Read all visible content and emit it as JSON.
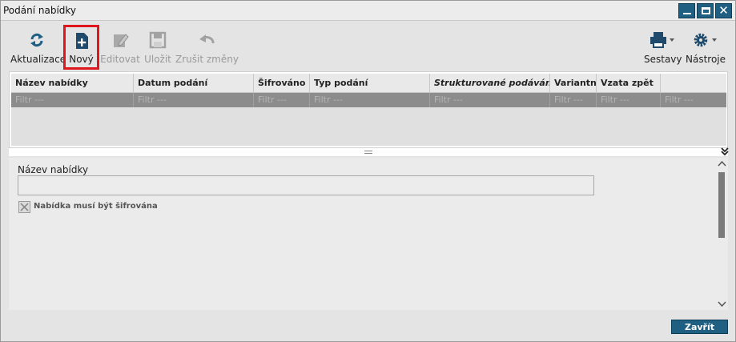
{
  "window": {
    "title": "Podání nabídky",
    "buttons": [
      "minimize",
      "maximize",
      "close"
    ]
  },
  "toolbar": {
    "items": [
      {
        "label": "Aktualizace",
        "icon": "refresh-icon",
        "enabled": true
      },
      {
        "label": "Nový",
        "icon": "new-document-icon",
        "enabled": true,
        "highlighted": true
      },
      {
        "label": "Editovat",
        "icon": "edit-icon",
        "enabled": false
      },
      {
        "label": "Uložit",
        "icon": "save-icon",
        "enabled": false
      },
      {
        "label": "Zrušit změny",
        "icon": "undo-icon",
        "enabled": false
      },
      {
        "label": "Sestavy",
        "icon": "print-icon",
        "enabled": true,
        "dropdown": true
      },
      {
        "label": "Nástroje",
        "icon": "gear-icon",
        "enabled": true,
        "dropdown": true
      }
    ]
  },
  "grid": {
    "columns": [
      {
        "label": "Název nabídky",
        "italic": false
      },
      {
        "label": "Datum podání",
        "italic": false
      },
      {
        "label": "Šifrováno",
        "italic": false
      },
      {
        "label": "Typ podání",
        "italic": false
      },
      {
        "label": "Strukturované podávání",
        "italic": true
      },
      {
        "label": "Variantní",
        "italic": false
      },
      {
        "label": "Vzata zpět",
        "italic": false
      },
      {
        "label": "",
        "italic": false
      }
    ],
    "filter_placeholder": "Filtr ---",
    "rows": []
  },
  "detail": {
    "name_label": "Název nabídky",
    "name_value": "",
    "encrypt_checkbox_label": "Nabídka musí být šifrována",
    "encrypt_checked": true
  },
  "footer": {
    "close_label": "Zavřít"
  },
  "colors": {
    "accent": "#1f5f82",
    "highlight": "#e0161d",
    "filter_row": "#8c8c8c"
  }
}
